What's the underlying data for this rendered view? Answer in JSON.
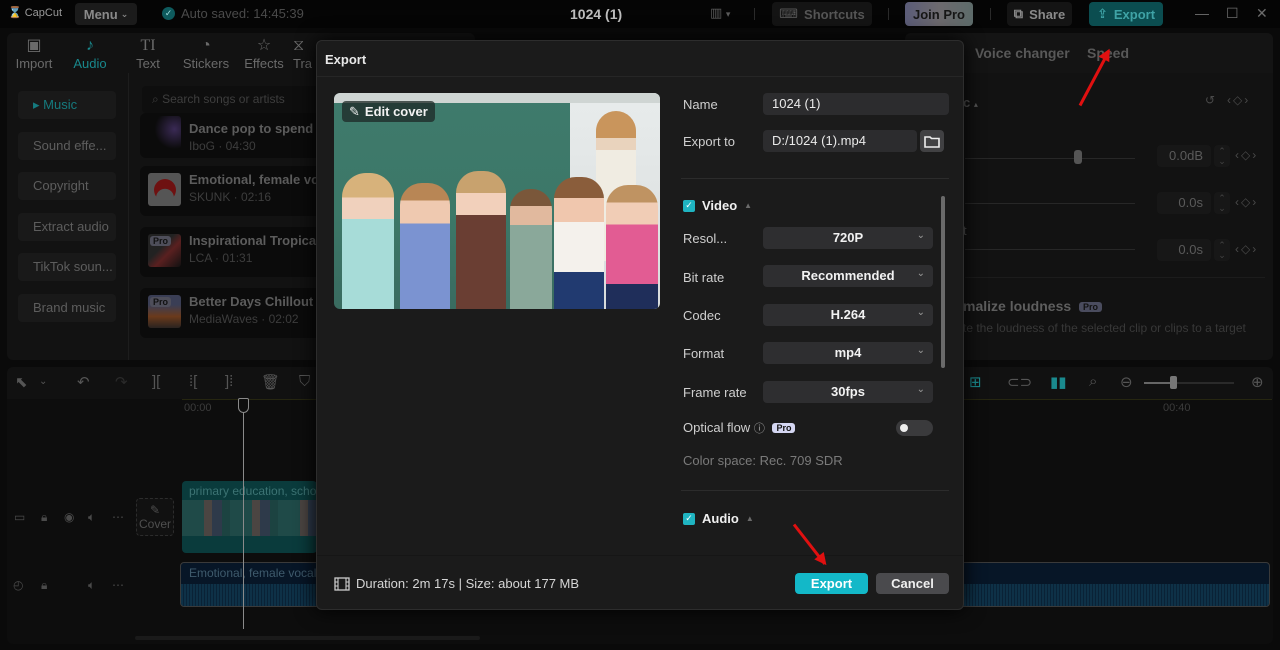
{
  "topbar": {
    "logo": "CapCut",
    "menu_label": "Menu",
    "autosave": "Auto saved: 14:45:39",
    "project_title": "1024 (1)",
    "shortcuts_label": "Shortcuts",
    "join_pro_label": "Join Pro",
    "share_label": "Share",
    "export_label": "Export"
  },
  "media_tabs": [
    {
      "label": "Import",
      "icon": "import-icon"
    },
    {
      "label": "Audio",
      "icon": "audio-icon",
      "active": true
    },
    {
      "label": "Text",
      "icon": "text-icon"
    },
    {
      "label": "Stickers",
      "icon": "stickers-icon"
    },
    {
      "label": "Effects",
      "icon": "effects-icon"
    },
    {
      "label": "Tra",
      "icon": "transitions-icon"
    }
  ],
  "audio_categories": [
    "Music",
    "Sound effe...",
    "Copyright",
    "Extract audio",
    "TikTok soun...",
    "Brand music"
  ],
  "search": {
    "placeholder": "Search songs or artists"
  },
  "songs": [
    {
      "title": "Dance pop to spend",
      "sub": "IboG · 04:30",
      "pro": false
    },
    {
      "title": "Emotional, female vo",
      "sub": "SKUNK · 02:16",
      "pro": false
    },
    {
      "title": "Inspirational Tropical",
      "sub": "LCA · 01:31",
      "pro": true
    },
    {
      "title": "Better Days Chillout",
      "sub": "MediaWaves · 02:02",
      "pro": true
    }
  ],
  "pro_label": "Pro",
  "right_panel": {
    "tabs": [
      "Voice changer",
      "Speed"
    ],
    "section_partial": "c",
    "volume_value": "0.0dB",
    "fade_in_value": "0.0s",
    "fade_out_label_partial": "t",
    "fade_out_value": "0.0s",
    "normalize_label": "malize loudness",
    "normalize_desc": "te the loudness of the selected clip or clips to a target"
  },
  "timeline": {
    "ruler_start": "00:00",
    "ruler_mark": "00:40",
    "cover_label": "Cover",
    "video_clip_label": "primary education, scho",
    "audio_clip_label": "Emotional, female vocals"
  },
  "export_dialog": {
    "title": "Export",
    "edit_cover_label": "Edit cover",
    "name_label": "Name",
    "name_value": "1024 (1)",
    "export_to_label": "Export to",
    "export_to_value": "D:/1024 (1).mp4",
    "video_section": "Video",
    "video_checked": true,
    "settings": [
      {
        "label": "Resol...",
        "value": "720P"
      },
      {
        "label": "Bit rate",
        "value": "Recommended"
      },
      {
        "label": "Codec",
        "value": "H.264"
      },
      {
        "label": "Format",
        "value": "mp4"
      },
      {
        "label": "Frame rate",
        "value": "30fps"
      }
    ],
    "optical_flow_label": "Optical flow",
    "optical_flow_on": false,
    "color_space": "Color space: Rec. 709 SDR",
    "audio_section": "Audio",
    "audio_checked": true,
    "footer_info": "Duration: 2m 17s | Size: about 177 MB",
    "export_button": "Export",
    "cancel_button": "Cancel"
  },
  "colors": {
    "accent": "#13b8c8",
    "annotation_arrow": "#e01010"
  }
}
